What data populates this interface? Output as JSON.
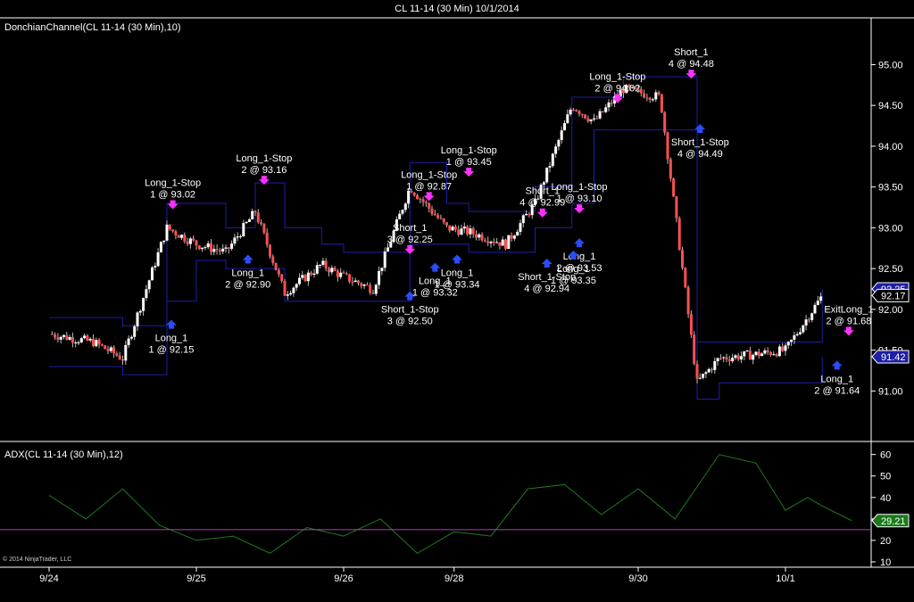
{
  "title": "CL 11-14 (30 Min)  10/1/2014",
  "colors": {
    "background": "#000000",
    "axis": "#ffffff",
    "up_candle": "#ffffff",
    "down_candle": "#ff5050",
    "donchian": "#1e1ea8",
    "adx": "#1f7a1f",
    "adx_threshold": "#b040b0",
    "long_arrow": "#2a4cff",
    "short_arrow": "#ff30ff",
    "adx_badge": "#1a7a1a",
    "price_badge": "#1e1ea8"
  },
  "x_axis": {
    "labels": [
      "9/24",
      "9/25",
      "9/26",
      "9/28",
      "9/30",
      "10/1"
    ],
    "positions": [
      0,
      1,
      2,
      2.75,
      4,
      5
    ]
  },
  "price_panel": {
    "indicator_label": "DonchianChannel(CL 11-14 (30 Min),10)",
    "ylim": [
      90.6,
      95.3
    ],
    "yticks": [
      "91.00",
      "91.50",
      "92.00",
      "92.50",
      "93.00",
      "93.50",
      "94.00",
      "94.50",
      "95.00"
    ],
    "badges": [
      {
        "text": "92.25",
        "value": 92.25
      },
      {
        "text": "92.17",
        "value": 92.17
      },
      {
        "text": "91.42",
        "value": 91.42
      }
    ]
  },
  "adx_panel": {
    "indicator_label": "ADX(CL 11-14 (30 Min),12)",
    "ylim": [
      10,
      64
    ],
    "yticks": [
      "10",
      "20",
      "30",
      "40",
      "50",
      "60"
    ],
    "badge": {
      "text": "29.21",
      "value": 29.21
    },
    "threshold": 25
  },
  "copyright": "© 2014 NinjaTrader, LLC",
  "chart_data": {
    "type": "line",
    "title": "CL 11-14 (30 Min)  10/1/2014",
    "xlabel": "",
    "ylabel": "",
    "x": [
      0.0,
      0.3,
      0.5,
      0.8,
      1.0,
      1.2,
      1.4,
      1.6,
      1.85,
      2.0,
      2.2,
      2.45,
      2.7,
      2.85,
      3.1,
      3.3,
      3.55,
      3.7,
      3.9,
      4.15,
      4.4,
      4.55,
      4.8,
      5.0,
      5.25
    ],
    "series": [
      {
        "name": "Close",
        "values": [
          91.7,
          91.6,
          91.4,
          93.0,
          92.8,
          92.7,
          93.2,
          92.2,
          92.55,
          92.4,
          92.25,
          93.5,
          93.0,
          92.95,
          92.8,
          93.3,
          94.5,
          94.3,
          94.7,
          94.6,
          91.1,
          91.4,
          91.45,
          91.5,
          92.17
        ]
      },
      {
        "name": "Donchian Upper",
        "values": [
          91.9,
          91.9,
          91.8,
          93.3,
          93.3,
          93.0,
          93.55,
          93.0,
          92.8,
          92.7,
          92.7,
          93.8,
          93.3,
          93.2,
          93.2,
          93.5,
          94.6,
          94.6,
          94.85,
          94.85,
          91.6,
          91.6,
          91.6,
          91.6,
          92.25
        ]
      },
      {
        "name": "Donchian Lower",
        "values": [
          91.3,
          91.3,
          91.2,
          92.1,
          92.6,
          92.5,
          92.5,
          92.1,
          92.1,
          92.1,
          92.1,
          92.8,
          92.8,
          92.7,
          92.7,
          93.0,
          93.3,
          94.2,
          94.2,
          94.2,
          90.9,
          91.1,
          91.1,
          91.1,
          91.42
        ]
      },
      {
        "name": "ADX",
        "values": [
          41,
          30,
          44,
          27,
          20,
          22,
          14,
          26,
          22,
          30,
          14,
          24,
          22,
          44,
          46,
          32,
          44,
          30,
          60,
          56,
          34,
          40,
          36,
          29.21
        ]
      }
    ],
    "adx_x": [
      0.0,
      0.25,
      0.5,
      0.75,
      1.0,
      1.25,
      1.5,
      1.75,
      2.0,
      2.25,
      2.5,
      2.75,
      3.0,
      3.25,
      3.5,
      3.75,
      4.0,
      4.25,
      4.55,
      4.8,
      5.0,
      5.15,
      5.25,
      5.45
    ],
    "annotations": [
      {
        "side": "short",
        "line1": "Long_1-Stop",
        "line2": "1 @ 93.02",
        "x": 0.84,
        "y": 93.25
      },
      {
        "side": "short",
        "line1": "Long_1-Stop",
        "line2": "2 @ 93.16",
        "x": 1.46,
        "y": 93.55
      },
      {
        "side": "long",
        "line1": "Long_1",
        "line2": "2 @ 92.90",
        "x": 1.35,
        "y": 92.65
      },
      {
        "side": "long",
        "line1": "Long_1",
        "line2": "1 @ 92.15",
        "x": 0.83,
        "y": 91.85
      },
      {
        "side": "short",
        "line1": "Short_1",
        "line2": "3 @ 92.25",
        "x": 2.45,
        "y": 92.7
      },
      {
        "side": "long",
        "line1": "Short_1-Stop",
        "line2": "3 @ 92.50",
        "x": 2.45,
        "y": 92.2
      },
      {
        "side": "short",
        "line1": "Long_1-Stop",
        "line2": "1 @ 92.87",
        "x": 2.58,
        "y": 93.35
      },
      {
        "side": "long",
        "line1": "Long_1",
        "line2": "1 @ 93.32",
        "x": 2.62,
        "y": 92.55
      },
      {
        "side": "short",
        "line1": "Long_1-Stop",
        "line2": "1 @ 93.45",
        "x": 2.85,
        "y": 93.65
      },
      {
        "side": "long",
        "line1": "Long_1",
        "line2": "1 @ 93.34",
        "x": 2.77,
        "y": 92.65
      },
      {
        "side": "short",
        "line1": "Short_1",
        "line2": "4 @ 92.99",
        "x": 3.35,
        "y": 93.15
      },
      {
        "side": "long",
        "line1": "Short_1-Stop",
        "line2": "4 @ 92.94",
        "x": 3.38,
        "y": 92.6
      },
      {
        "side": "short",
        "line1": "Long_1-Stop",
        "line2": "1 @ 93.10",
        "x": 3.6,
        "y": 93.2
      },
      {
        "side": "long",
        "line1": "Long_1",
        "line2": "2 @ 93.53",
        "x": 3.6,
        "y": 92.85
      },
      {
        "side": "long",
        "line1": "Long_1",
        "line2": "1 @ 93.35",
        "x": 3.56,
        "y": 92.7
      },
      {
        "side": "short",
        "line1": "Long_1-Stop",
        "line2": "2 @ 94.02",
        "x": 3.86,
        "y": 94.55
      },
      {
        "side": "short",
        "line1": "Short_1",
        "line2": "4 @ 94.48",
        "x": 4.36,
        "y": 94.85
      },
      {
        "side": "long",
        "line1": "Short_1-Stop",
        "line2": "4 @ 94.49",
        "x": 4.42,
        "y": 94.25
      },
      {
        "side": "short",
        "line1": "ExitLong_1",
        "line2": "2 @ 91.68",
        "x": 5.43,
        "y": 91.7
      },
      {
        "side": "long",
        "line1": "Long_1",
        "line2": "2 @ 91.64",
        "x": 5.35,
        "y": 91.35
      }
    ]
  }
}
